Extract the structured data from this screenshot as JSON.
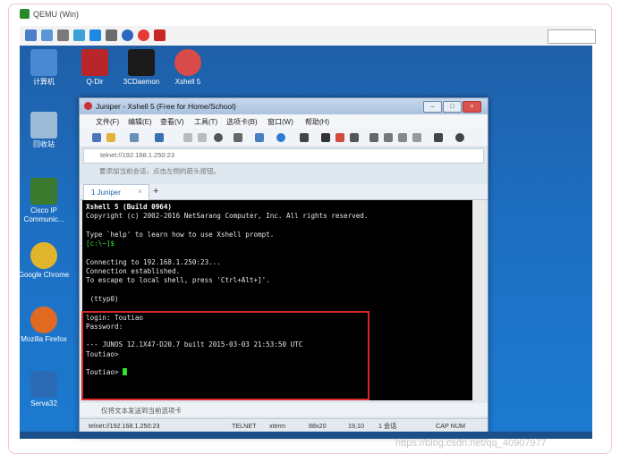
{
  "qemu": {
    "title": "QEMU (Win)"
  },
  "desktop": {
    "icons": [
      {
        "label": "计算机",
        "color": "#4b88d3"
      },
      {
        "label": "Q-Dir",
        "color": "#b8262a"
      },
      {
        "label": "3CDaemon",
        "color": "#1a1a1a"
      },
      {
        "label": "Xshell 5",
        "color": "#d94a4a"
      },
      {
        "label": "回收站",
        "color": "#9bbad6"
      },
      {
        "label": "Cisco IP Communic...",
        "color": "#3b7a2f"
      },
      {
        "label": "Google Chrome",
        "color": "#e0b52b"
      },
      {
        "label": "Mozilla Firefox",
        "color": "#e06a22"
      },
      {
        "label": "Serva32",
        "color": "#2b6bb5"
      }
    ]
  },
  "xshell": {
    "title": "Juniper - Xshell 5 (Free for Home/School)",
    "menu": [
      "文件(F)",
      "编辑(E)",
      "查看(V)",
      "工具(T)",
      "选项卡(B)",
      "窗口(W)",
      "帮助(H)"
    ],
    "address": "telnet://192.168.1.250:23",
    "hint": "要添加当前会话，点击左侧的箭头按钮。",
    "tab_label": "1 Juniper",
    "add_tab": "+",
    "terminal": {
      "line1": "Xshell 5 (Build 0964)",
      "line2": "Copyright (c) 2002-2016 NetSarang Computer, Inc. All rights reserved.",
      "line3": "Type `help' to learn how to use Xshell prompt.",
      "line4": "[c:\\~]$",
      "line5": "Connecting to 192.168.1.250:23...",
      "line6": "Connection established.",
      "line7": "To escape to local shell, press 'Ctrl+Alt+]'.",
      "line8": " (ttyp0)",
      "line9": "login: Toutiao",
      "line10": "Password:",
      "line11": "--- JUNOS 12.1X47-D20.7 built 2015-03-03 21:53:50 UTC",
      "line12": "Toutiao>",
      "line13": "Toutiao> "
    },
    "sendbar": "仅将文本发送到当前选项卡",
    "status": {
      "address": "telnet://192.168.1.250:23",
      "protocol": "TELNET",
      "term": "xterm",
      "size": "88x20",
      "pos": "19,10",
      "sessions": "1 会话",
      "caps": "CAP NUM"
    }
  },
  "watermark": "https://blog.csdn.net/qq_40907977"
}
